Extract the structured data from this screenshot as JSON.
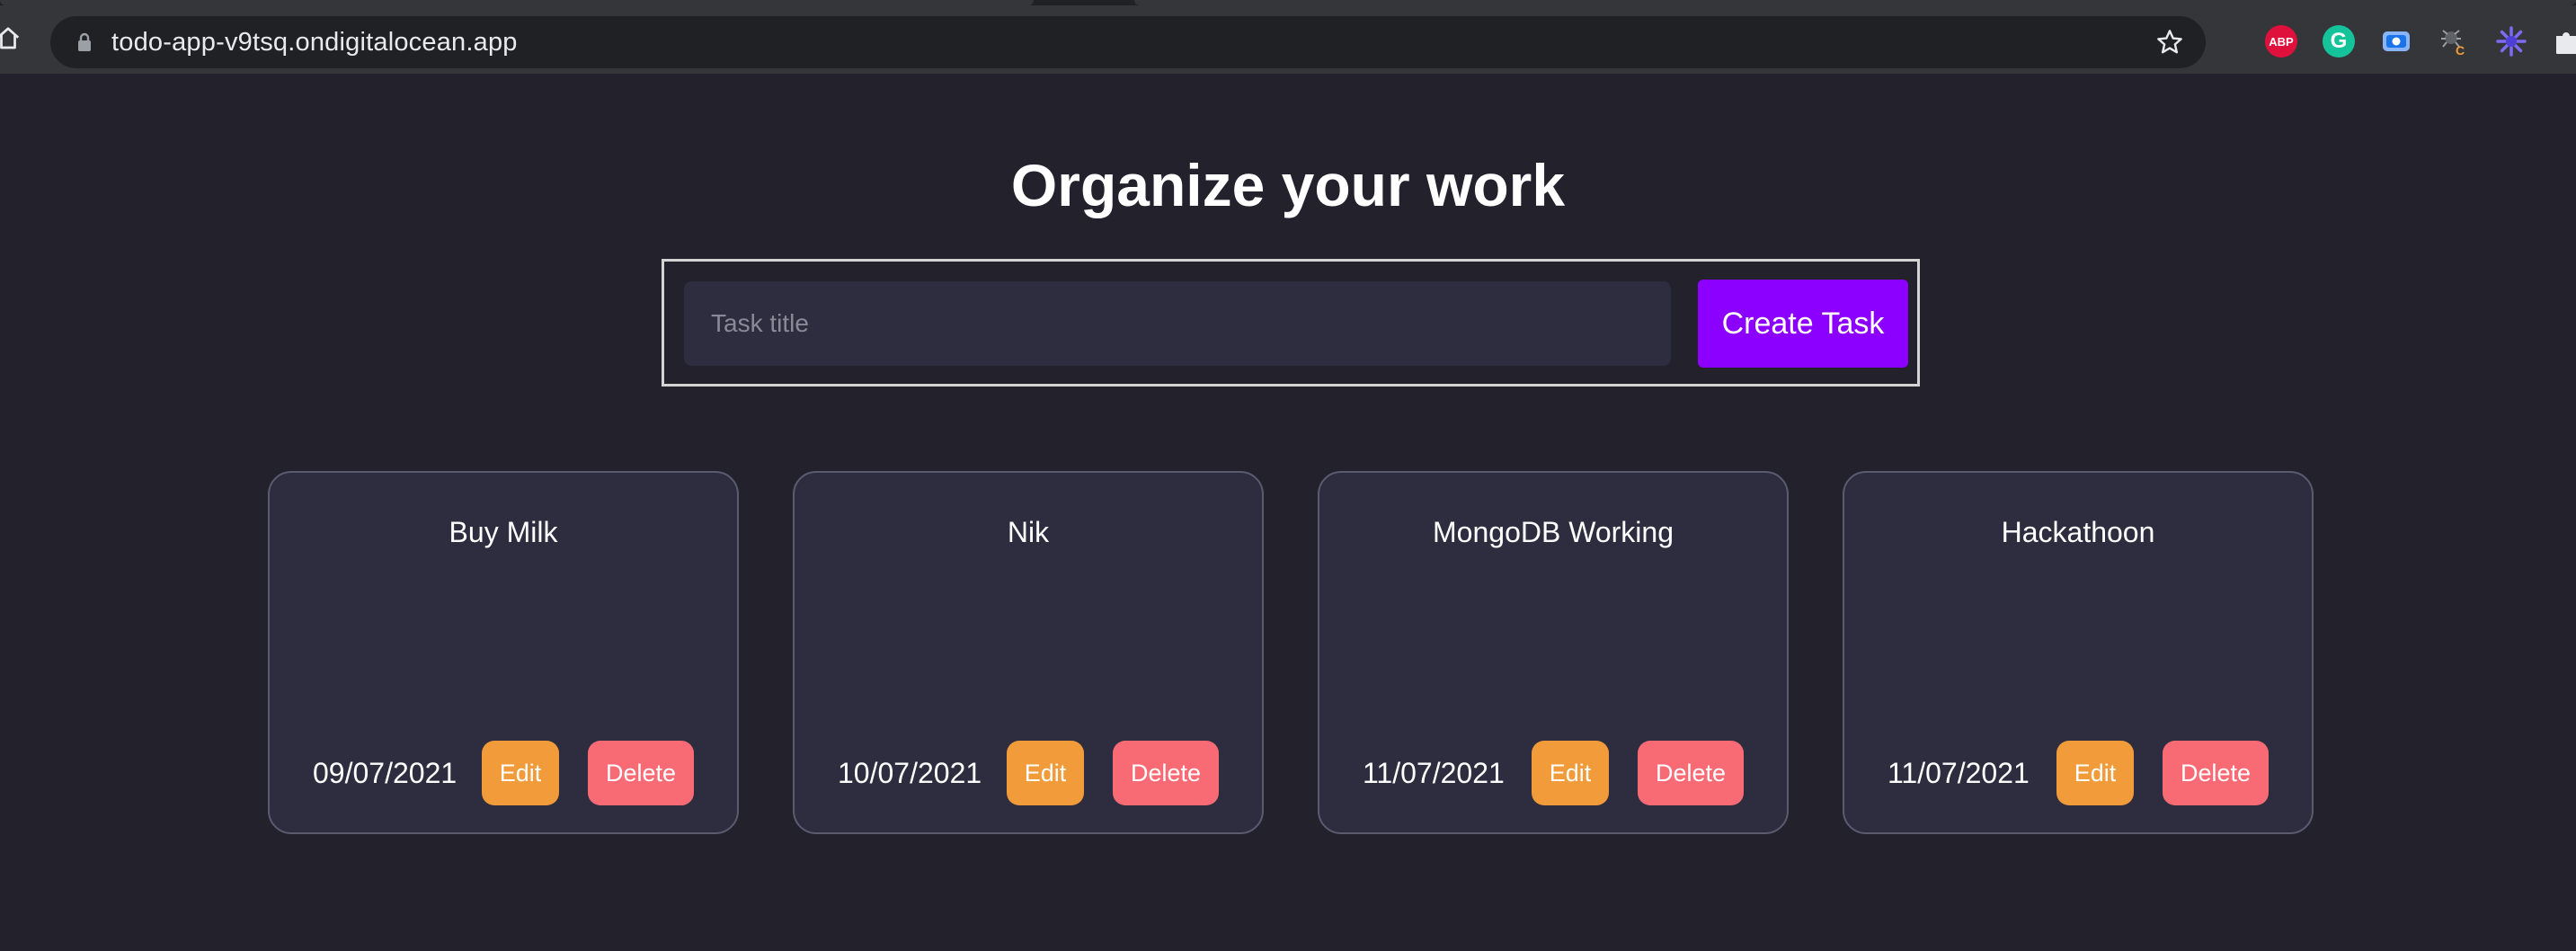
{
  "browser": {
    "url": "todo-app-v9tsq.ondigitalocean.app",
    "icons": [
      "home-icon",
      "lock-icon",
      "star-icon"
    ],
    "extensions": [
      {
        "name": "adblock-plus-extension-icon",
        "label": "ABP",
        "color": "#e0103c"
      },
      {
        "name": "grammarly-extension-icon",
        "label": "G",
        "color": "#15c39a"
      },
      {
        "name": "screen-capture-extension-icon",
        "label": "",
        "color": "#8ab4f8"
      },
      {
        "name": "bug-extension-icon",
        "label": "",
        "color": "#f29b3a"
      },
      {
        "name": "gear-extension-icon",
        "label": "",
        "color": "#6c5ce7"
      },
      {
        "name": "puzzle-extensions-icon",
        "label": "",
        "color": "#e8eaed"
      }
    ]
  },
  "page": {
    "title": "Organize your work",
    "form": {
      "input_placeholder": "Task title",
      "input_value": "",
      "create_label": "Create Task"
    }
  },
  "tasks": [
    {
      "title": "Buy Milk",
      "date": "09/07/2021",
      "edit_label": "Edit",
      "delete_label": "Delete"
    },
    {
      "title": "Nik",
      "date": "10/07/2021",
      "edit_label": "Edit",
      "delete_label": "Delete"
    },
    {
      "title": "MongoDB Working",
      "date": "11/07/2021",
      "edit_label": "Edit",
      "delete_label": "Delete"
    },
    {
      "title": "Hackathoon",
      "date": "11/07/2021",
      "edit_label": "Edit",
      "delete_label": "Delete"
    }
  ],
  "colors": {
    "background": "#22212c",
    "card": "#2e2d40",
    "accent": "#8b00ff",
    "edit": "#f29b3a",
    "delete": "#f86b75"
  }
}
